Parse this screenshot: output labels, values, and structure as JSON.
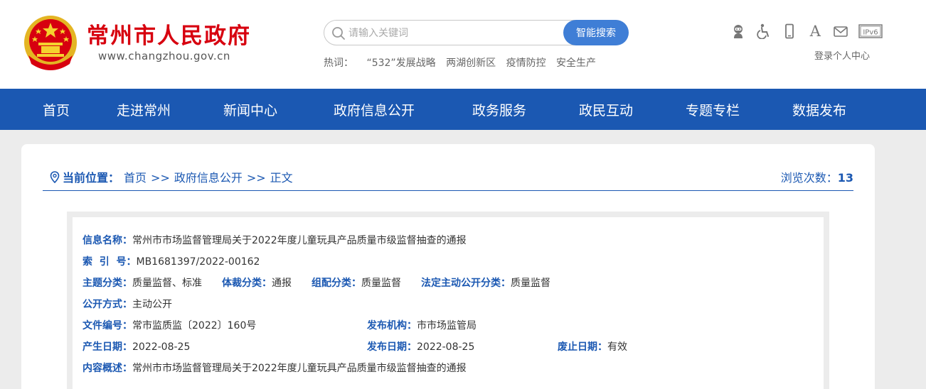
{
  "header": {
    "site_name": "常州市人民政府",
    "site_url": "www.changzhou.gov.cn",
    "search": {
      "placeholder": "请输入关键词",
      "button_label": "智能搜索"
    },
    "hot": {
      "label": "热词：",
      "terms": [
        "“532”发展战略",
        "两湖创新区",
        "疫情防控",
        "安全生产"
      ]
    },
    "tools": [
      "robot-icon",
      "accessibility-icon",
      "mobile-icon",
      "font-size-icon",
      "mail-icon",
      "ipv6-icon"
    ],
    "tool_a_glyph": "A",
    "ipv6_label": "IPv6",
    "login_link": "登录个人中心"
  },
  "nav": [
    "首页",
    "走进常州",
    "新闻中心",
    "政府信息公开",
    "政务服务",
    "政民互动",
    "专题专栏",
    "数据发布"
  ],
  "breadcrumb": {
    "label": "当前位置：",
    "items": [
      "首页",
      "政府信息公开",
      "正文"
    ],
    "separator": ">>"
  },
  "views": {
    "label": "浏览次数：",
    "count": "13"
  },
  "info": {
    "name_label": "信息名称：",
    "name_value": "常州市市场监督管理局关于2022年度儿童玩具产品质量市级监督抽查的通报",
    "index_label": "索  引  号：",
    "index_value": "MB1681397/2022-00162",
    "topic_label": "主题分类：",
    "topic_value": "质量监督、标准",
    "genre_label": "体裁分类：",
    "genre_value": "通报",
    "org_cat_label": "组配分类：",
    "org_cat_value": "质量监督",
    "legal_label": "法定主动公开分类：",
    "legal_value": "质量监督",
    "open_label": "公开方式：",
    "open_value": "主动公开",
    "doc_no_label": "文件编号：",
    "doc_no_value": "常市监质监〔2022〕160号",
    "publisher_label": "发布机构：",
    "publisher_value": "市市场监管局",
    "created_label": "产生日期：",
    "created_value": "2022-08-25",
    "published_label": "发布日期：",
    "published_value": "2022-08-25",
    "expiry_label": "废止日期：",
    "expiry_value": "有效",
    "summary_label": "内容概述：",
    "summary_value": "常州市市场监督管理局关于2022年度儿童玩具产品质量市级监督抽查的通报"
  },
  "colors": {
    "brand_red": "#d7000f",
    "nav_blue": "#1b58b2",
    "search_blue": "#3f7ed6"
  }
}
